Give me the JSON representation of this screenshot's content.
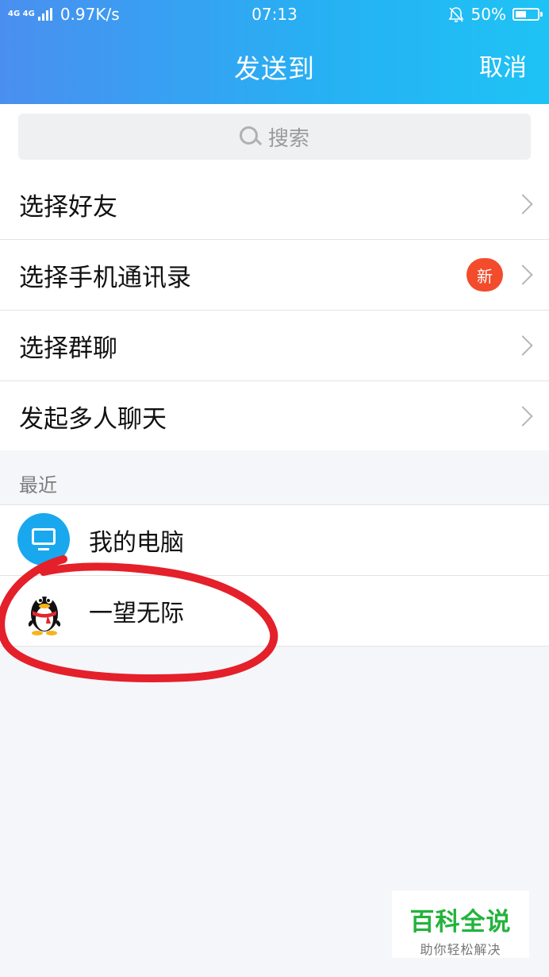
{
  "status_bar": {
    "network_type": "4G 4G",
    "speed": "0.97K/s",
    "time": "07:13",
    "battery": "50%",
    "battery_level": 0.5
  },
  "nav": {
    "title": "发送到",
    "cancel_label": "取消"
  },
  "search": {
    "placeholder": "搜索"
  },
  "menu": {
    "items": [
      {
        "label": "选择好友"
      },
      {
        "label": "选择手机通讯录",
        "badge": "新"
      },
      {
        "label": "选择群聊"
      },
      {
        "label": "发起多人聊天"
      }
    ]
  },
  "recent": {
    "header": "最近",
    "items": [
      {
        "name": "我的电脑",
        "avatar": "computer-icon"
      },
      {
        "name": "一望无际",
        "avatar": "qq-penguin-avatar"
      }
    ]
  },
  "annotation": {
    "color": "#e4202a"
  },
  "watermark": {
    "title": "百科全说",
    "subtitle": "助你轻松解决"
  },
  "colors": {
    "header_start": "#4a8ff0",
    "header_end": "#1ec3f5",
    "badge": "#f24c2c",
    "watermark_green": "#23b33c"
  }
}
